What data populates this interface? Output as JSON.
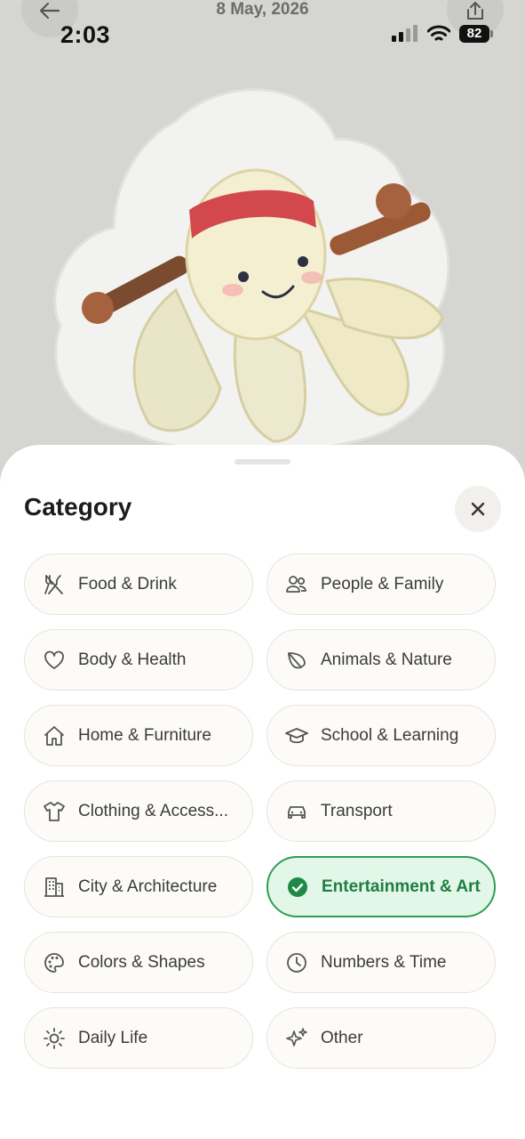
{
  "header": {
    "date": "8 May, 2026",
    "back_icon": "arrow-left-icon",
    "share_icon": "share-icon"
  },
  "status_bar": {
    "time": "2:03",
    "battery": "82"
  },
  "sheet": {
    "title": "Category",
    "close_icon": "close-icon",
    "categories": [
      {
        "label": "Food & Drink",
        "icon": "fork-knife-icon",
        "selected": false
      },
      {
        "label": "People & Family",
        "icon": "people-icon",
        "selected": false
      },
      {
        "label": "Body & Health",
        "icon": "heart-icon",
        "selected": false
      },
      {
        "label": "Animals & Nature",
        "icon": "leaf-icon",
        "selected": false
      },
      {
        "label": "Home & Furniture",
        "icon": "house-icon",
        "selected": false
      },
      {
        "label": "School & Learning",
        "icon": "graduation-cap-icon",
        "selected": false
      },
      {
        "label": "Clothing & Access...",
        "icon": "shirt-icon",
        "selected": false
      },
      {
        "label": "Transport",
        "icon": "car-icon",
        "selected": false
      },
      {
        "label": "City & Architecture",
        "icon": "building-icon",
        "selected": false
      },
      {
        "label": "Entertainment & Art",
        "icon": "check-circle-icon",
        "selected": true
      },
      {
        "label": "Colors & Shapes",
        "icon": "palette-icon",
        "selected": false
      },
      {
        "label": "Numbers & Time",
        "icon": "clock-icon",
        "selected": false
      },
      {
        "label": "Daily Life",
        "icon": "sun-icon",
        "selected": false
      },
      {
        "label": "Other",
        "icon": "sparkles-icon",
        "selected": false
      }
    ]
  },
  "colors": {
    "accent": "#2f9e57",
    "selected_bg": "#e3f7e9",
    "chip_border": "#e6e4dd",
    "backdrop": "#d5d5d2"
  }
}
